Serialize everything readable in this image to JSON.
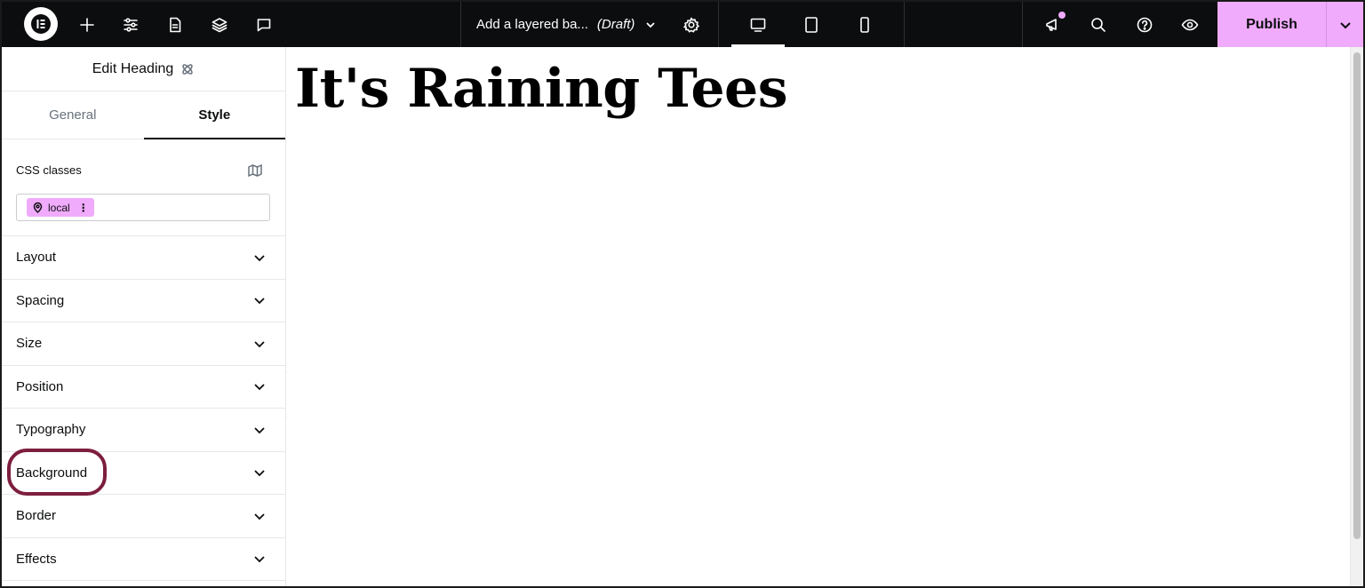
{
  "topbar": {
    "doc_title": "Add a layered ba...",
    "doc_status": "(Draft)",
    "publish_label": "Publish",
    "icons": [
      "elementor-logo-icon",
      "plus-icon",
      "sliders-icon",
      "page-icon",
      "layers-icon",
      "chat-icon",
      "chevron-down-icon",
      "gear-icon",
      "desktop-icon",
      "tablet-icon",
      "mobile-icon",
      "megaphone-icon",
      "search-icon",
      "help-icon",
      "eye-icon"
    ]
  },
  "panel": {
    "title": "Edit Heading",
    "tabs": [
      {
        "label": "General",
        "active": false
      },
      {
        "label": "Style",
        "active": true
      }
    ],
    "css_classes": {
      "label": "CSS classes",
      "chip": "local"
    },
    "sections": [
      {
        "label": "Layout"
      },
      {
        "label": "Spacing"
      },
      {
        "label": "Size"
      },
      {
        "label": "Position"
      },
      {
        "label": "Typography"
      },
      {
        "label": "Background",
        "highlighted": true
      },
      {
        "label": "Border"
      },
      {
        "label": "Effects"
      }
    ]
  },
  "canvas": {
    "heading": "It's Raining Tees"
  },
  "colors": {
    "topbar_bg": "#0c0d0e",
    "accent_pink": "#f0abfc",
    "highlight_ring": "#7d1e3f"
  }
}
